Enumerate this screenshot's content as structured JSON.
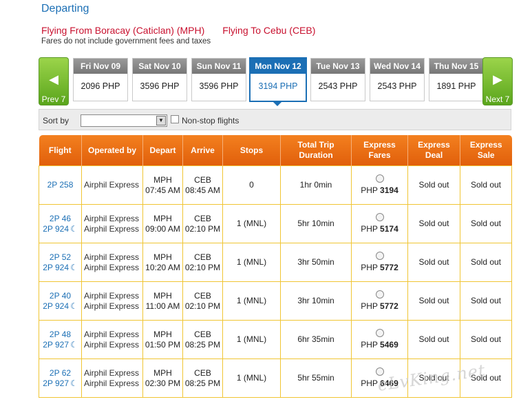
{
  "header": {
    "title": "Departing",
    "from": "Flying From Boracay (Caticlan) (MPH)",
    "to": "Flying To Cebu (CEB)",
    "note": "Fares do not include government fees and taxes"
  },
  "date_nav": {
    "prev_label": "Prev 7",
    "next_label": "Next 7",
    "days": [
      {
        "label": "Fri Nov 09",
        "price": "2096 PHP"
      },
      {
        "label": "Sat Nov 10",
        "price": "3596 PHP"
      },
      {
        "label": "Sun Nov 11",
        "price": "3596 PHP"
      },
      {
        "label": "Mon Nov 12",
        "price": "3194 PHP"
      },
      {
        "label": "Tue Nov 13",
        "price": "2543 PHP"
      },
      {
        "label": "Wed Nov 14",
        "price": "2543 PHP"
      },
      {
        "label": "Thu Nov 15",
        "price": "1891 PHP"
      }
    ],
    "selected_index": 3
  },
  "sort": {
    "label": "Sort by",
    "selected": "",
    "nonstop_label": "Non-stop flights",
    "nonstop_checked": false
  },
  "table": {
    "headers": {
      "flight": "Flight",
      "operated_by": "Operated by",
      "depart": "Depart",
      "arrive": "Arrive",
      "stops": "Stops",
      "duration": "Total Trip Duration",
      "express_fares": "Express Fares",
      "express_deal": "Express Deal",
      "express_sale": "Express Sale"
    },
    "rows": [
      {
        "flight1": "2P 258",
        "flight2": "",
        "op1": "Airphil Express",
        "op2": "",
        "dep_code": "MPH",
        "dep_time": "07:45 AM",
        "arr_code": "CEB",
        "arr_time": "08:45 AM",
        "stops": "0",
        "duration": "1hr 0min",
        "fare_cur": "PHP",
        "fare_amt": "3194",
        "deal": "Sold out",
        "sale": "Sold out"
      },
      {
        "flight1": "2P 46",
        "flight2": "2P 924",
        "op1": "Airphil Express",
        "op2": "Airphil Express",
        "dep_code": "MPH",
        "dep_time": "09:00 AM",
        "arr_code": "CEB",
        "arr_time": "02:10 PM",
        "stops": "1 (MNL)",
        "duration": "5hr 10min",
        "fare_cur": "PHP",
        "fare_amt": "5174",
        "deal": "Sold out",
        "sale": "Sold out"
      },
      {
        "flight1": "2P 52",
        "flight2": "2P 924",
        "op1": "Airphil Express",
        "op2": "Airphil Express",
        "dep_code": "MPH",
        "dep_time": "10:20 AM",
        "arr_code": "CEB",
        "arr_time": "02:10 PM",
        "stops": "1 (MNL)",
        "duration": "3hr 50min",
        "fare_cur": "PHP",
        "fare_amt": "5772",
        "deal": "Sold out",
        "sale": "Sold out"
      },
      {
        "flight1": "2P 40",
        "flight2": "2P 924",
        "op1": "Airphil Express",
        "op2": "Airphil Express",
        "dep_code": "MPH",
        "dep_time": "11:00 AM",
        "arr_code": "CEB",
        "arr_time": "02:10 PM",
        "stops": "1 (MNL)",
        "duration": "3hr 10min",
        "fare_cur": "PHP",
        "fare_amt": "5772",
        "deal": "Sold out",
        "sale": "Sold out"
      },
      {
        "flight1": "2P 48",
        "flight2": "2P 927",
        "op1": "Airphil Express",
        "op2": "Airphil Express",
        "dep_code": "MPH",
        "dep_time": "01:50 PM",
        "arr_code": "CEB",
        "arr_time": "08:25 PM",
        "stops": "1 (MNL)",
        "duration": "6hr 35min",
        "fare_cur": "PHP",
        "fare_amt": "5469",
        "deal": "Sold out",
        "sale": "Sold out"
      },
      {
        "flight1": "2P 62",
        "flight2": "2P 927",
        "op1": "Airphil Express",
        "op2": "Airphil Express",
        "dep_code": "MPH",
        "dep_time": "02:30 PM",
        "arr_code": "CEB",
        "arr_time": "08:25 PM",
        "stops": "1 (MNL)",
        "duration": "5hr 55min",
        "fare_cur": "PHP",
        "fare_amt": "6469",
        "deal": "Sold out",
        "sale": "Sold out"
      }
    ]
  },
  "watermark": "eLvKing.net",
  "icons": {
    "night_flight": "moon-icon",
    "prev": "left-arrow-icon",
    "next": "right-arrow-icon"
  }
}
